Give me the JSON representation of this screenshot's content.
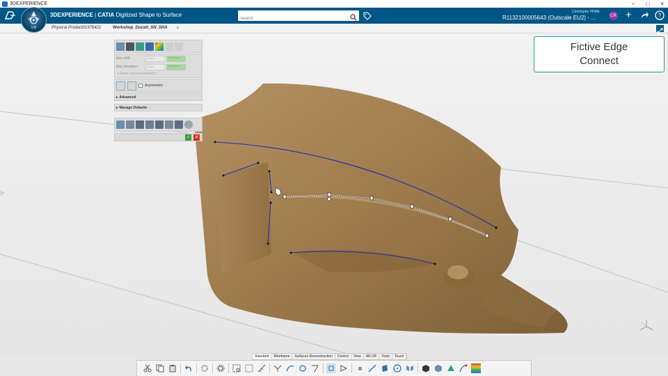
{
  "os": {
    "title": "3DEXPERIENCE",
    "controls": [
      "–",
      "□",
      "×"
    ]
  },
  "header": {
    "brand": "3DEXPERIENCE",
    "product": "CATIA",
    "app": "Digitized Shape to Surface",
    "compass_version": "V.R",
    "user": "Christophe PHME",
    "tenant": "R1132100005643  (Outscale EU2) - ...",
    "avatar_initials": "CR",
    "brand_color": "#005686"
  },
  "search": {
    "placeholder": "Search",
    "value": ""
  },
  "tabs": [
    {
      "label": "Physical Product01976421"
    },
    {
      "label": "Workshop_Ducati_SN_SHA"
    }
  ],
  "tab_add": "+",
  "panel": {
    "max_drift_label": "Max drift",
    "max_drift_value": "0mm",
    "max_drift_result": "0.000mm",
    "max_deviation_label": "Max deviation",
    "max_deviation_value": "0mm",
    "max_deviation_result": "0.008mm",
    "more_link": "More curve parameters",
    "asymmetric_label": "Asymmetric",
    "advanced_label": "Advanced",
    "manage_defaults_label": "Manage Defaults"
  },
  "callout": {
    "line1": "Fictive Edge",
    "line2": "Connect"
  },
  "bottom_tabs": [
    "Standard",
    "Wireframe",
    "Surfaces Reconstruction",
    "Control",
    "View",
    "AR-VR",
    "Tools",
    "Touch"
  ],
  "bottom_active_tab": "Standard",
  "colors": {
    "surface": "#9c7a4c",
    "curve": "#2a2ab0",
    "accept": "#3e9b3e",
    "cancel": "#d02c22",
    "callout_border": "#2a9a8a"
  }
}
